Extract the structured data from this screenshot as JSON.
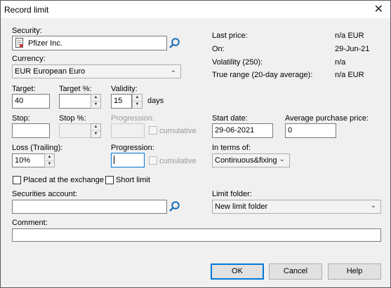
{
  "window": {
    "title": "Record limit"
  },
  "labels": {
    "security": "Security:",
    "currency": "Currency:",
    "target": "Target:",
    "target_pct": "Target %:",
    "validity": "Validity:",
    "days": "days",
    "stop": "Stop:",
    "stop_pct": "Stop %:",
    "progression_disabled": "Progression:",
    "cumulative": "cumulative",
    "loss_trailing": "Loss (Trailing):",
    "progression": "Progression:",
    "placed_at_exchange": "Placed at the exchange",
    "short_limit": "Short limit",
    "securities_account": "Securities account:",
    "comment": "Comment:",
    "start_date": "Start date:",
    "avg_purchase_price": "Average purchase price:",
    "in_terms_of": "In terms of:",
    "limit_folder": "Limit folder:"
  },
  "fields": {
    "security": "Pfizer Inc.",
    "currency": "EUR European Euro",
    "target": "40",
    "target_pct": "",
    "validity": "15",
    "stop": "",
    "stop_pct": "",
    "progression_disabled": "",
    "loss_trailing": "10%",
    "progression": "",
    "securities_account": "",
    "comment": "",
    "start_date": "29-06-2021",
    "avg_purchase_price": "0",
    "in_terms_of": "Continuous&fixing",
    "limit_folder": "New limit folder"
  },
  "info": [
    {
      "label": "Last price:",
      "value": "n/a EUR"
    },
    {
      "label": "On:",
      "value": "29-Jun-21"
    },
    {
      "label": "Volatility (250):",
      "value": "n/a"
    },
    {
      "label": "True range (20-day average):",
      "value": "n/a EUR"
    }
  ],
  "buttons": {
    "ok": "OK",
    "cancel": "Cancel",
    "help": "Help"
  },
  "colors": {
    "accent": "#0078d7",
    "background": "#f0f0f0"
  },
  "icons": {
    "close": "close-icon",
    "search": "magnifier-icon",
    "security": "document-icon"
  }
}
